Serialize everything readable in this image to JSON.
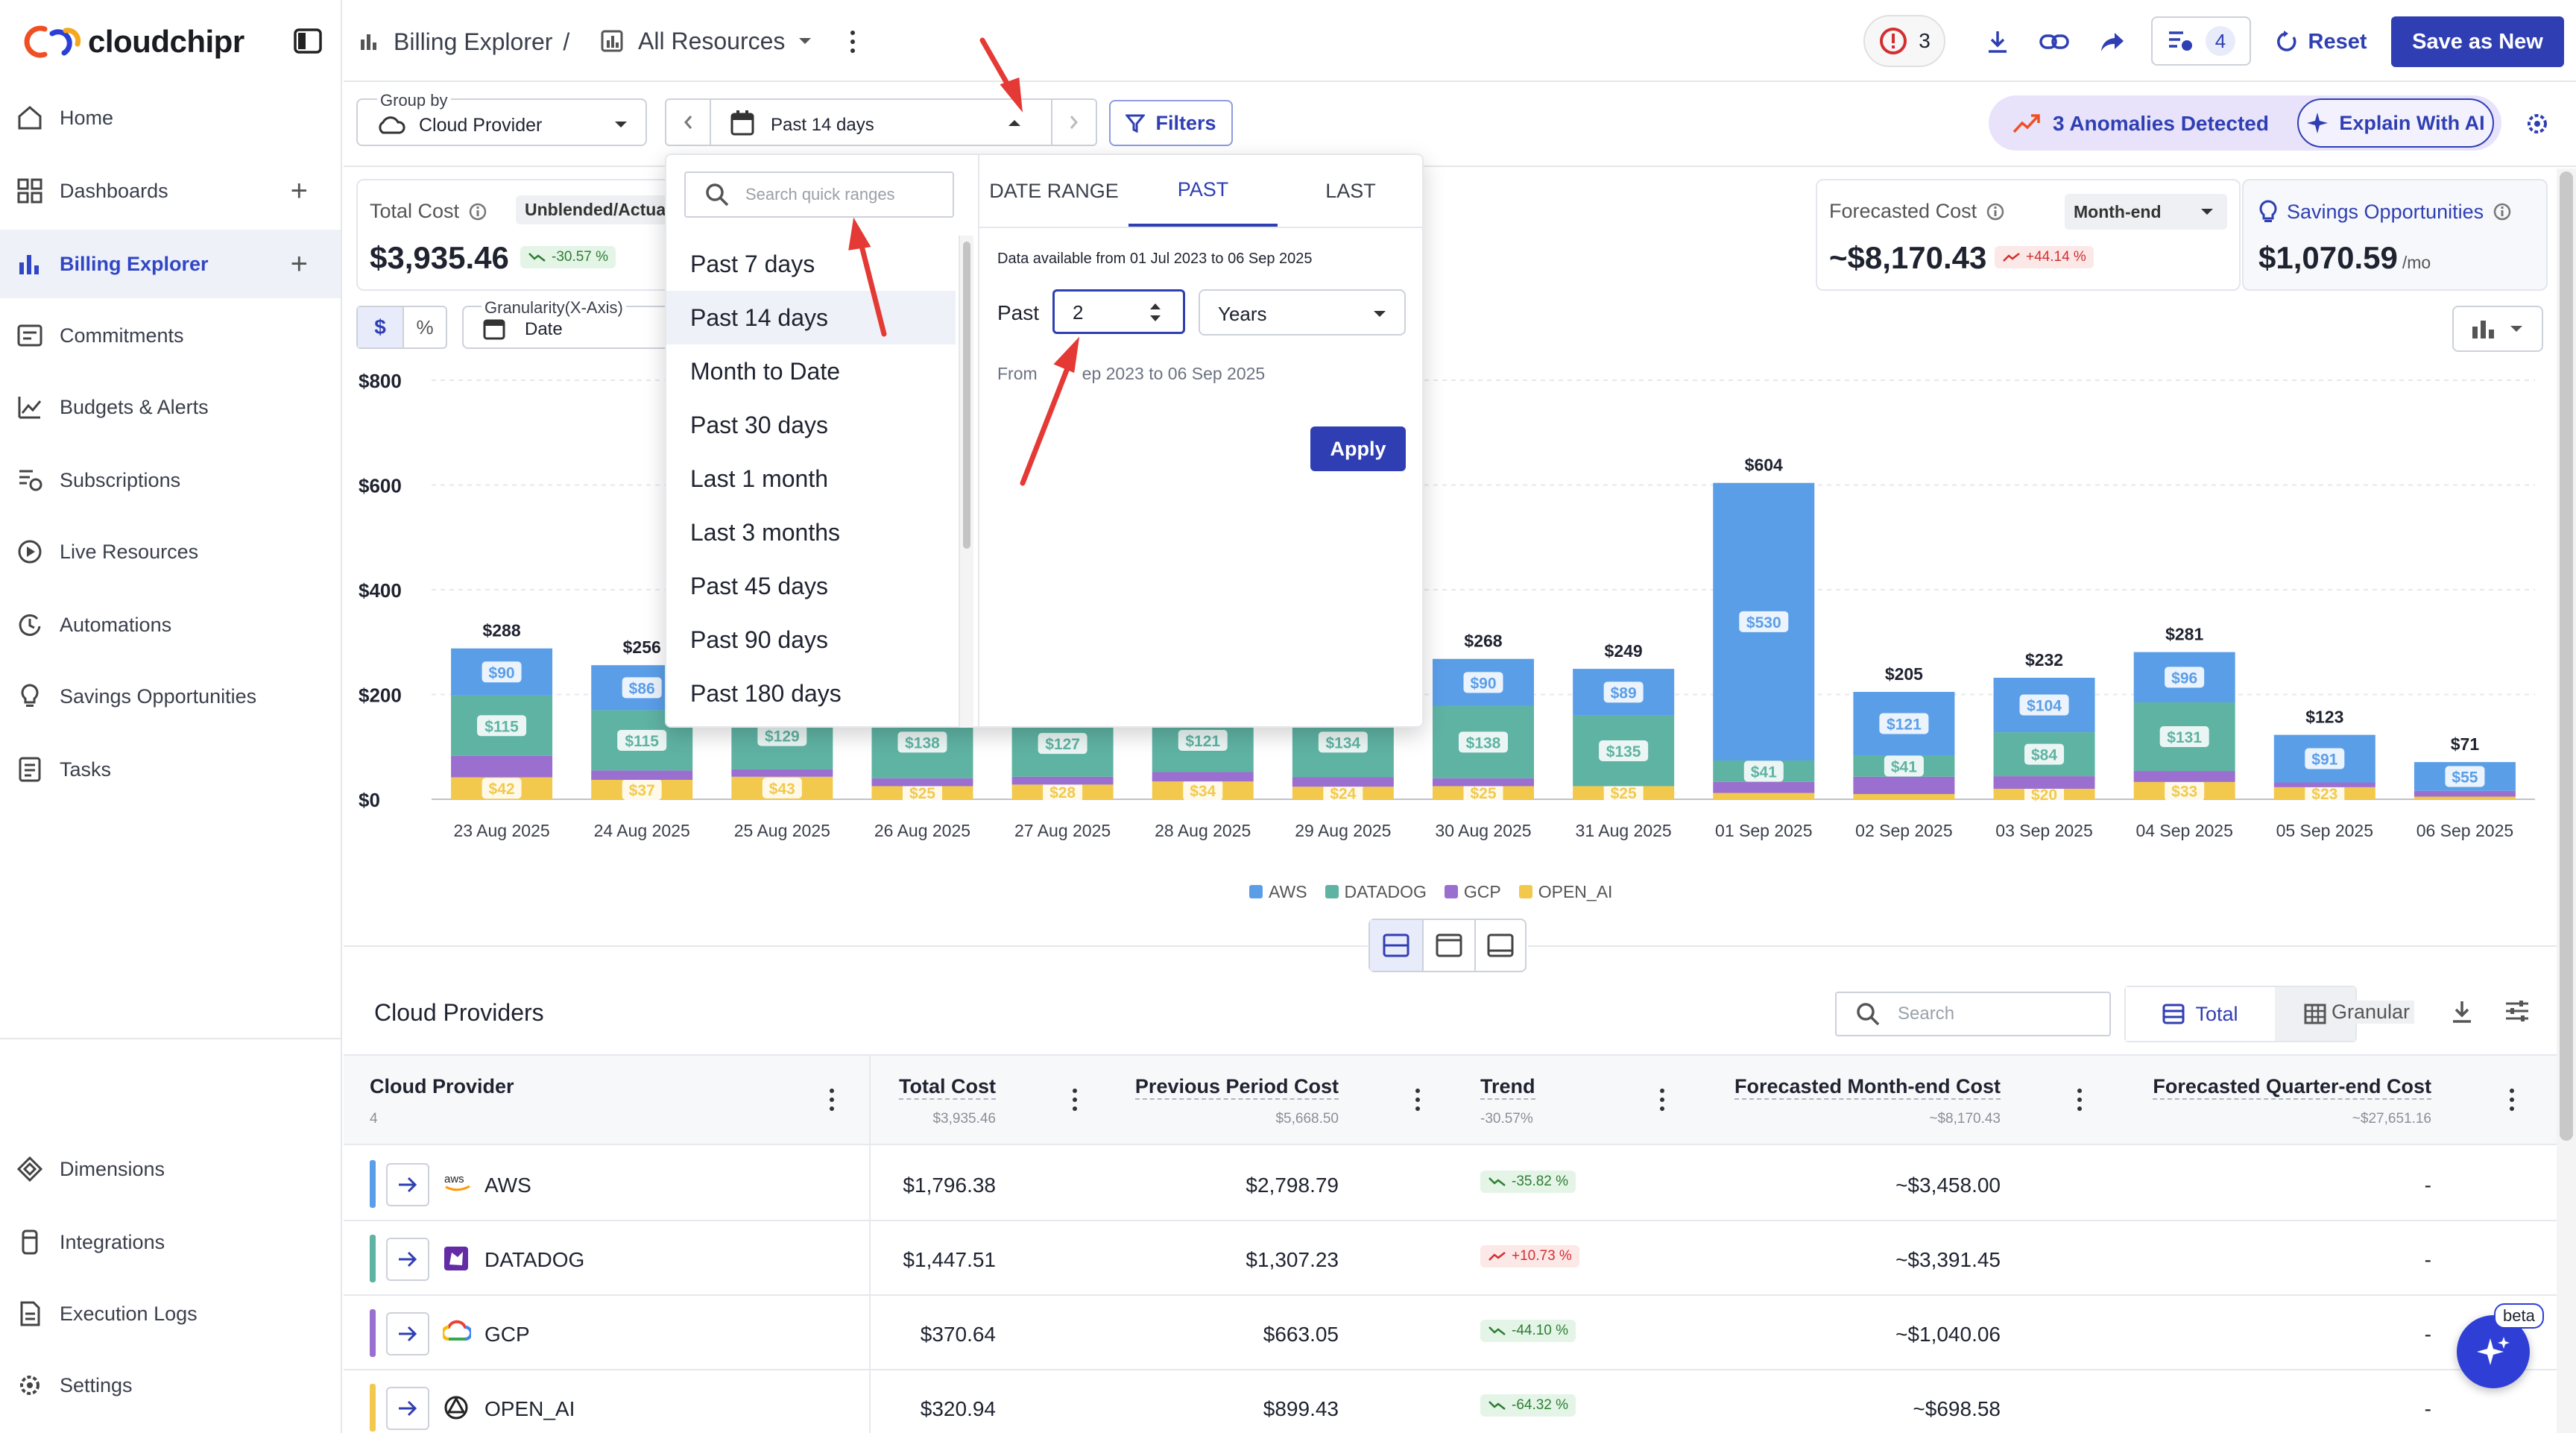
{
  "app": {
    "logo": "cloudchipr"
  },
  "sidebar": {
    "items": [
      {
        "label": "Home",
        "icon": "home-icon"
      },
      {
        "label": "Dashboards",
        "icon": "dashboard-icon"
      },
      {
        "label": "Billing Explorer",
        "icon": "bar-chart-icon"
      },
      {
        "label": "Commitments",
        "icon": "commitments-icon"
      },
      {
        "label": "Budgets & Alerts",
        "icon": "budget-icon"
      },
      {
        "label": "Subscriptions",
        "icon": "subscriptions-icon"
      },
      {
        "label": "Live Resources",
        "icon": "play-circle-icon"
      },
      {
        "label": "Automations",
        "icon": "automation-icon"
      },
      {
        "label": "Savings Opportunities",
        "icon": "lightbulb-icon"
      },
      {
        "label": "Tasks",
        "icon": "tasks-icon"
      }
    ],
    "bottom_items": [
      {
        "label": "Dimensions",
        "icon": "dimensions-icon"
      },
      {
        "label": "Integrations",
        "icon": "integrations-icon"
      },
      {
        "label": "Execution Logs",
        "icon": "logs-icon"
      },
      {
        "label": "Settings",
        "icon": "gear-icon"
      }
    ]
  },
  "header": {
    "breadcrumb_root": "Billing Explorer",
    "breadcrumb_sep": "/",
    "view_name": "All Resources",
    "alerts_count": "3",
    "tasks_count": "4",
    "reset_label": "Reset",
    "save_label": "Save as New"
  },
  "toolbar": {
    "group_by_label": "Group by",
    "group_by_value": "Cloud Provider",
    "date_value": "Past 14 days",
    "filters_label": "Filters",
    "anomalies_label": "3 Anomalies Detected",
    "explain_label": "Explain With AI"
  },
  "summary": {
    "total_cost_label": "Total Cost",
    "total_cost_type": "Unblended/Actua",
    "total_cost_value": "$3,935.46",
    "total_cost_trend": "-30.57 %",
    "forecast_label": "Forecasted Cost",
    "forecast_period": "Month-end",
    "forecast_value": "~$8,170.43",
    "forecast_trend": "+44.14 %",
    "savings_label": "Savings Opportunities",
    "savings_value": "$1,070.59",
    "savings_unit": "/mo"
  },
  "chart_controls": {
    "dollar": "$",
    "percent": "%",
    "granularity_label": "Granularity(X-Axis)",
    "granularity_value": "Date"
  },
  "popup": {
    "search_placeholder": "Search quick ranges",
    "quick_ranges": [
      "Past 7 days",
      "Past 14 days",
      "Month to Date",
      "Past 30 days",
      "Last 1 month",
      "Last 3 months",
      "Past 45 days",
      "Past 90 days",
      "Past 180 days"
    ],
    "selected_range": "Past 14 days",
    "tabs": [
      "DATE RANGE",
      "PAST",
      "LAST"
    ],
    "active_tab": "PAST",
    "available_text": "Data available from 01 Jul 2023 to 06 Sep 2025",
    "past_label": "Past",
    "past_value": "2",
    "unit_value": "Years",
    "from_prefix": "From",
    "from_text": "ep 2023 to 06 Sep 2025",
    "apply_label": "Apply"
  },
  "chart_data": {
    "type": "bar",
    "stacked": true,
    "categories": [
      "23 Aug 2025",
      "24 Aug 2025",
      "25 Aug 2025",
      "26 Aug 2025",
      "27 Aug 2025",
      "28 Aug 2025",
      "29 Aug 2025",
      "30 Aug 2025",
      "31 Aug 2025",
      "01 Sep 2025",
      "02 Sep 2025",
      "03 Sep 2025",
      "04 Sep 2025",
      "05 Sep 2025",
      "06 Sep 2025"
    ],
    "totals": [
      "$288",
      "$256",
      "",
      "",
      "",
      "",
      "",
      "$268",
      "$249",
      "$604",
      "$205",
      "$232",
      "$281",
      "$123",
      "$71"
    ],
    "series": [
      {
        "name": "OPEN_AI",
        "color": "#f2c94c",
        "values": [
          42,
          37,
          43,
          25,
          28,
          34,
          24,
          25,
          25,
          12,
          10,
          20,
          33,
          23,
          5
        ]
      },
      {
        "name": "GCP",
        "color": "#9b6fcf",
        "values": [
          41,
          18,
          14,
          15,
          15,
          18,
          18,
          15,
          0,
          21,
          33,
          24,
          21,
          9,
          11
        ]
      },
      {
        "name": "DATADOG",
        "color": "#5fb3a3",
        "values": [
          115,
          115,
          129,
          138,
          127,
          121,
          134,
          138,
          135,
          41,
          41,
          84,
          131,
          0,
          0
        ]
      },
      {
        "name": "AWS",
        "color": "#5b9ee8",
        "values": [
          90,
          86,
          0,
          0,
          0,
          0,
          0,
          90,
          89,
          530,
          121,
          104,
          96,
          91,
          55
        ]
      }
    ],
    "segment_labels": {
      "AWS": [
        "$90",
        "$86",
        "",
        "",
        "",
        "",
        "",
        "$90",
        "$89",
        "$530",
        "$121",
        "$104",
        "$96",
        "$91",
        "$55"
      ],
      "DATADOG": [
        "$115",
        "$115",
        "$129",
        "$138",
        "$127",
        "$121",
        "$134",
        "$138",
        "$135",
        "$41",
        "$41",
        "$84",
        "$131",
        "",
        ""
      ],
      "GCP": [
        "",
        "",
        "",
        "",
        "",
        "",
        "",
        "",
        "",
        "",
        "",
        "",
        "",
        "",
        ""
      ],
      "OPEN_AI": [
        "$42",
        "$37",
        "$43",
        "$25",
        "$28",
        "$34",
        "$24",
        "$25",
        "$25",
        "",
        "",
        "$20",
        "$33",
        "$23",
        ""
      ]
    },
    "yticks": [
      "$800",
      "$600",
      "$400",
      "$200",
      "$0"
    ],
    "ylim": [
      0,
      800
    ],
    "legend": [
      "AWS",
      "DATADOG",
      "GCP",
      "OPEN_AI"
    ],
    "legend_position": "bottom"
  },
  "table": {
    "title": "Cloud Providers",
    "search_placeholder": "Search",
    "total_label": "Total",
    "granular_label": "Granular",
    "columns": [
      {
        "label": "Cloud Provider",
        "sub": "4"
      },
      {
        "label": "Total Cost",
        "sub": "$3,935.46"
      },
      {
        "label": "Previous Period Cost",
        "sub": "$5,668.50"
      },
      {
        "label": "Trend",
        "sub": "-30.57%"
      },
      {
        "label": "Forecasted Month-end Cost",
        "sub": "~$8,170.43"
      },
      {
        "label": "Forecasted Quarter-end Cost",
        "sub": "~$27,651.16"
      }
    ],
    "rows": [
      {
        "name": "AWS",
        "color": "#5b9ee8",
        "total": "$1,796.38",
        "prev": "$2,798.79",
        "trend": "-35.82 %",
        "dir": "down",
        "month": "~$3,458.00",
        "quarter": "-"
      },
      {
        "name": "DATADOG",
        "color": "#5fb3a3",
        "total": "$1,447.51",
        "prev": "$1,307.23",
        "trend": "+10.73 %",
        "dir": "up",
        "month": "~$3,391.45",
        "quarter": "-"
      },
      {
        "name": "GCP",
        "color": "#9b6fcf",
        "total": "$370.64",
        "prev": "$663.05",
        "trend": "-44.10 %",
        "dir": "down",
        "month": "~$1,040.06",
        "quarter": "-"
      },
      {
        "name": "OPEN_AI",
        "color": "#f2c94c",
        "total": "$320.94",
        "prev": "$899.43",
        "trend": "-64.32 %",
        "dir": "down",
        "month": "~$698.58",
        "quarter": "-"
      }
    ]
  },
  "ai_badge": "beta",
  "colors": {
    "accent": "#3146c6",
    "save_bg": "#2f3fb3",
    "danger": "#d32f2f",
    "success": "#2e7d32",
    "annotation": "#e53935"
  }
}
